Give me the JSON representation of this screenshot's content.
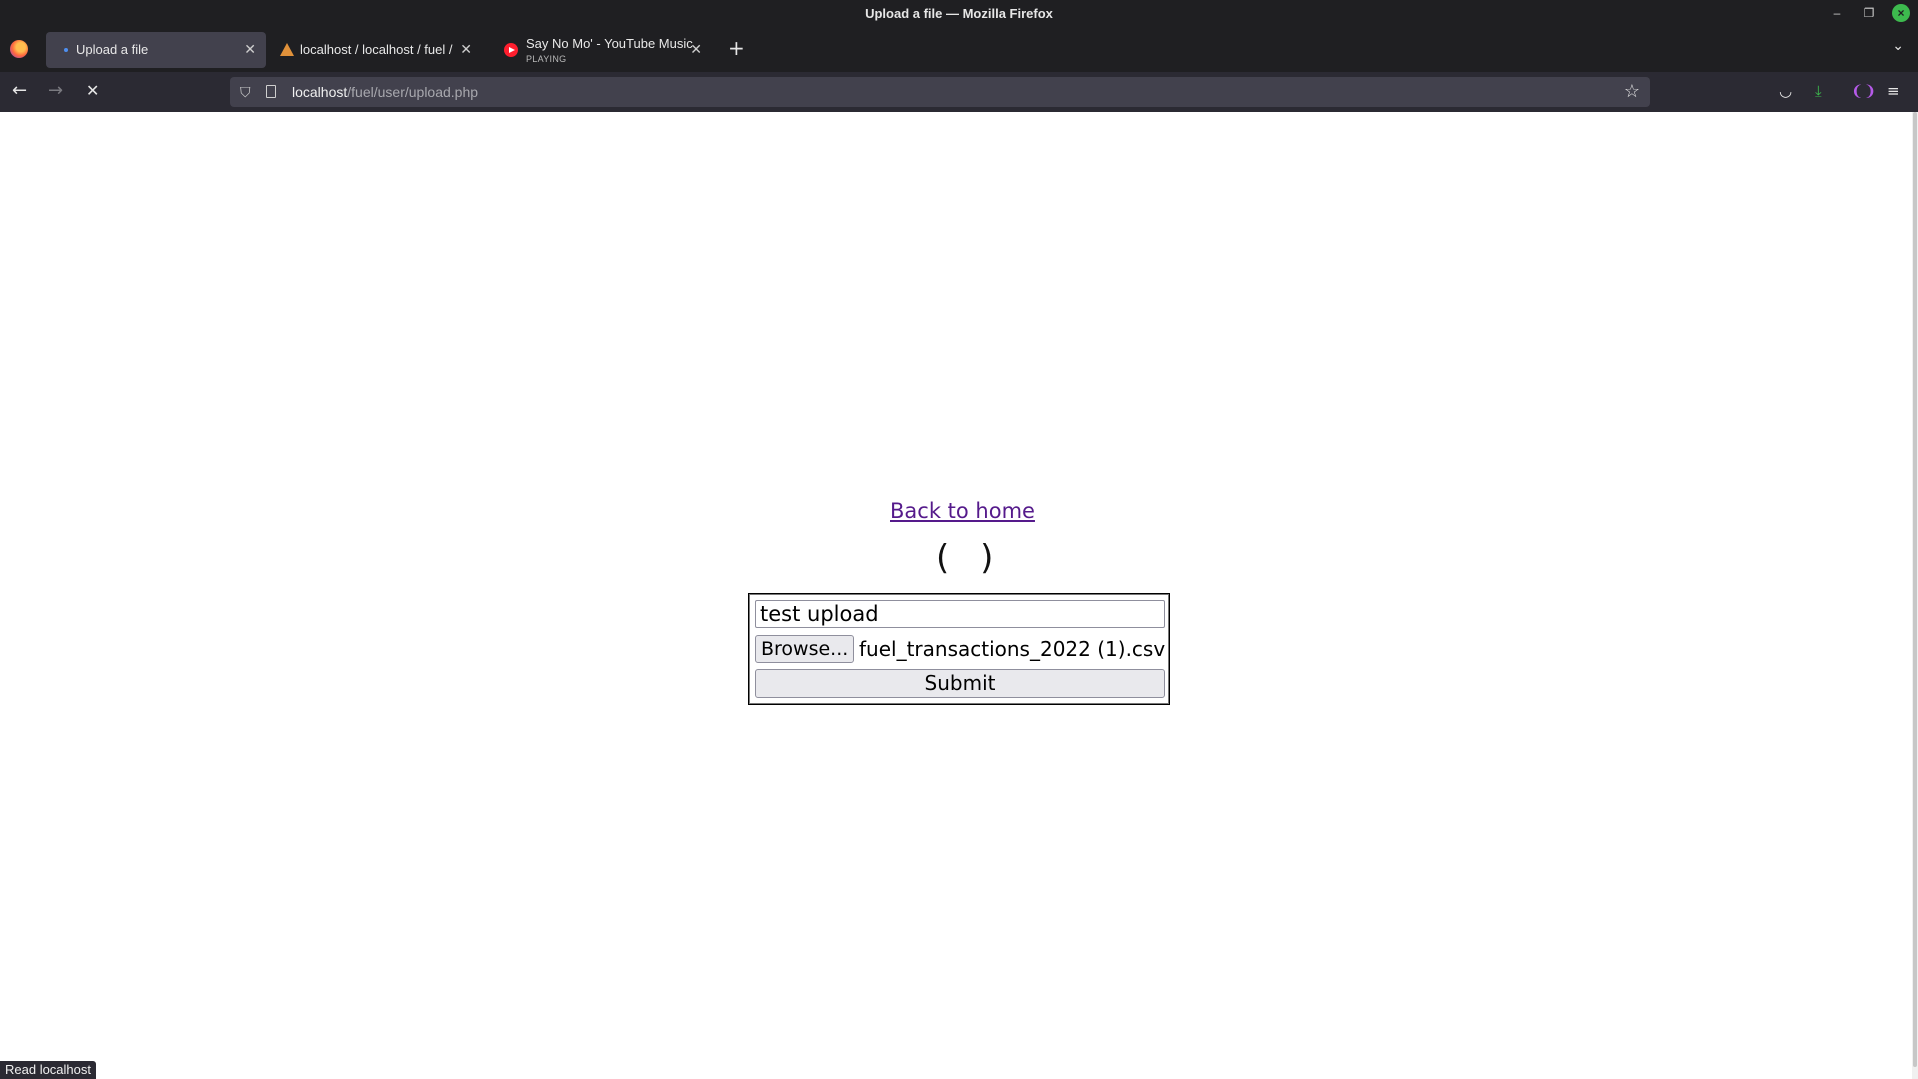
{
  "window": {
    "title": "Upload a file — Mozilla Firefox"
  },
  "tabs": [
    {
      "label": "Upload a file",
      "active": true,
      "favicon": "loading-dot-icon"
    },
    {
      "label": "localhost / localhost / fuel /",
      "active": false,
      "favicon": "phpmyadmin-icon"
    },
    {
      "label": "Say No Mo' - YouTube Music",
      "sublabel": "PLAYING",
      "active": false,
      "favicon": "youtube-music-icon"
    }
  ],
  "nav": {
    "url_host": "localhost",
    "url_path": "/fuel/user/upload.php"
  },
  "page": {
    "home_link": "Back to home",
    "spinner": "( )",
    "title_value": "test upload",
    "browse_label": "Browse...",
    "file_name": "fuel_transactions_2022 (1).csv",
    "submit_label": "Submit"
  },
  "status_text": "Read localhost",
  "colors": {
    "link": "#551a8b",
    "chrome": "#1f1f22",
    "toolbar": "#2b2a33",
    "active_tab": "#42414d"
  }
}
